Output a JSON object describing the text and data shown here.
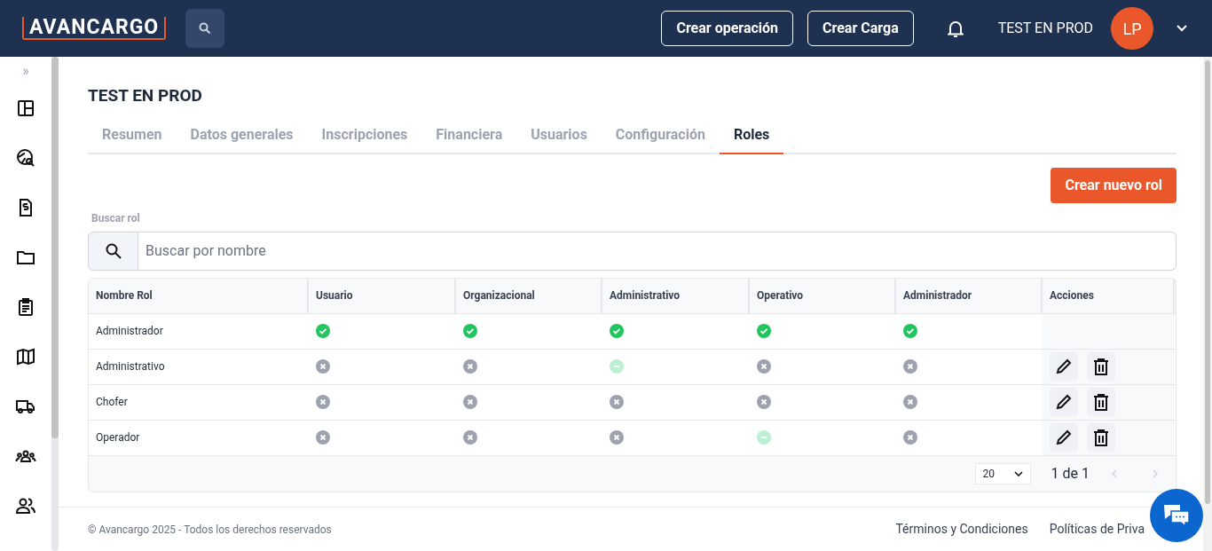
{
  "header": {
    "logo": "AVANCARGO",
    "buttons": [
      "Crear operación",
      "Crear Carga"
    ],
    "user_name": "TEST EN PROD",
    "avatar": "LP"
  },
  "sidebar": {
    "expand": "»",
    "items": [
      {
        "kind": "dashboard"
      },
      {
        "kind": "globe-search"
      },
      {
        "kind": "invoice"
      },
      {
        "kind": "folder"
      },
      {
        "kind": "clipboard"
      },
      {
        "kind": "map"
      },
      {
        "kind": "truck"
      },
      {
        "kind": "team"
      },
      {
        "kind": "users"
      }
    ]
  },
  "page": {
    "title": "TEST EN PROD",
    "tabs": [
      {
        "label": "Resumen",
        "selected": false
      },
      {
        "label": "Datos generales",
        "selected": false
      },
      {
        "label": "Inscripciones",
        "selected": false
      },
      {
        "label": "Financiera",
        "selected": false
      },
      {
        "label": "Usuarios",
        "selected": false
      },
      {
        "label": "Configuración",
        "selected": false
      },
      {
        "label": "Roles",
        "selected": true
      }
    ],
    "create_button": "Crear nuevo rol",
    "search": {
      "label": "Buscar rol",
      "placeholder": "Buscar por nombre"
    },
    "table": {
      "columns": [
        "Nombre Rol",
        "Usuario",
        "Organizacional",
        "Administrativo",
        "Operativo",
        "Administrador",
        "Acciones"
      ],
      "rows": [
        {
          "name": "Administrador",
          "permissions": [
            {
              "kind": "yes"
            },
            {
              "kind": "yes"
            },
            {
              "kind": "yes"
            },
            {
              "kind": "yes"
            },
            {
              "kind": "yes"
            }
          ],
          "actions": false
        },
        {
          "name": "Administrativo",
          "permissions": [
            {
              "kind": "no"
            },
            {
              "kind": "no"
            },
            {
              "kind": "partial"
            },
            {
              "kind": "no"
            },
            {
              "kind": "no"
            }
          ],
          "actions": true
        },
        {
          "name": "Chofer",
          "permissions": [
            {
              "kind": "no"
            },
            {
              "kind": "no"
            },
            {
              "kind": "no"
            },
            {
              "kind": "no"
            },
            {
              "kind": "no"
            }
          ],
          "actions": true
        },
        {
          "name": "Operador",
          "permissions": [
            {
              "kind": "no"
            },
            {
              "kind": "no"
            },
            {
              "kind": "no"
            },
            {
              "kind": "partial"
            },
            {
              "kind": "no"
            }
          ],
          "actions": true
        }
      ]
    },
    "pagination": {
      "page_size": "20",
      "page_info": "1 de 1"
    }
  },
  "footer": {
    "copyright": "© Avancargo 2025 - Todos los derechos reservados",
    "links": [
      "Términos y Condiciones",
      "Políticas de Priva"
    ]
  }
}
